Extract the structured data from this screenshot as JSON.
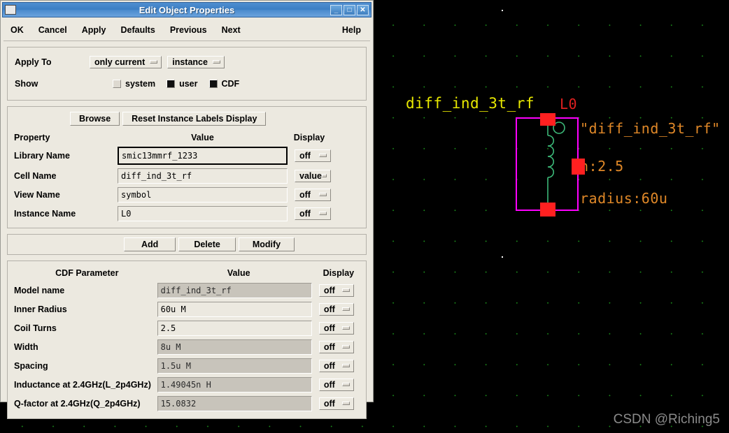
{
  "window": {
    "title": "Edit Object Properties",
    "icon": "window-icon",
    "buttons": {
      "minimize": "_",
      "maximize": "□",
      "close": "✕"
    }
  },
  "menubar": {
    "items": [
      {
        "label": "OK",
        "name": "ok-button"
      },
      {
        "label": "Cancel",
        "name": "cancel-button"
      },
      {
        "label": "Apply",
        "name": "apply-button"
      },
      {
        "label": "Defaults",
        "name": "defaults-button"
      },
      {
        "label": "Previous",
        "name": "previous-button"
      },
      {
        "label": "Next",
        "name": "next-button"
      }
    ],
    "help": "Help"
  },
  "apply_section": {
    "apply_to_label": "Apply To",
    "apply_to_scope": "only current",
    "apply_to_object": "instance",
    "show_label": "Show",
    "show_options": [
      {
        "label": "system",
        "checked": false
      },
      {
        "label": "user",
        "checked": true
      },
      {
        "label": "CDF",
        "checked": true
      }
    ]
  },
  "property_section": {
    "browse_label": "Browse",
    "reset_label": "Reset Instance Labels Display",
    "headers": {
      "property": "Property",
      "value": "Value",
      "display": "Display"
    },
    "rows": [
      {
        "label": "Library Name",
        "value": "smic13mmrf_1233",
        "display": "off",
        "focused": true,
        "disabled": false
      },
      {
        "label": "Cell Name",
        "value": "diff_ind_3t_rf",
        "display": "value",
        "focused": false,
        "disabled": false
      },
      {
        "label": "View Name",
        "value": "symbol",
        "display": "off",
        "focused": false,
        "disabled": false
      },
      {
        "label": "Instance Name",
        "value": "L0",
        "display": "off",
        "focused": false,
        "disabled": false
      }
    ]
  },
  "action_bar": {
    "add": "Add",
    "delete": "Delete",
    "modify": "Modify"
  },
  "cdf_section": {
    "headers": {
      "parameter": "CDF Parameter",
      "value": "Value",
      "display": "Display"
    },
    "rows": [
      {
        "label": "Model name",
        "value": "diff_ind_3t_rf",
        "display": "off",
        "disabled": true
      },
      {
        "label": "Inner Radius",
        "value": "60u M",
        "display": "off",
        "disabled": false
      },
      {
        "label": "Coil Turns",
        "value": "2.5",
        "display": "off",
        "disabled": false
      },
      {
        "label": "Width",
        "value": "8u M",
        "display": "off",
        "disabled": true
      },
      {
        "label": "Spacing",
        "value": "1.5u M",
        "display": "off",
        "disabled": true
      },
      {
        "label": "Inductance at 2.4GHz(L_2p4GHz)",
        "value": "1.49045n H",
        "display": "off",
        "disabled": true
      },
      {
        "label": "Q-factor at 2.4GHz(Q_2p4GHz)",
        "value": "15.0832",
        "display": "off",
        "disabled": true
      }
    ]
  },
  "schematic": {
    "cell_label": "diff_ind_3t_rf",
    "instance_label": "L0",
    "model_label": "\"diff_ind_3t_rf\"",
    "turns_label": "n:2.5",
    "radius_label": "radius:60u",
    "colors": {
      "background": "#000000",
      "grid_dot": "#1b8c1b",
      "body_outline": "#ff00ff",
      "pin": "#ff2020",
      "coil": "#3cb878",
      "cell_text": "#e8e800",
      "instance_text": "#e02020",
      "property_text": "#e08828"
    }
  },
  "watermark": {
    "text": "CSDN @Riching5"
  }
}
